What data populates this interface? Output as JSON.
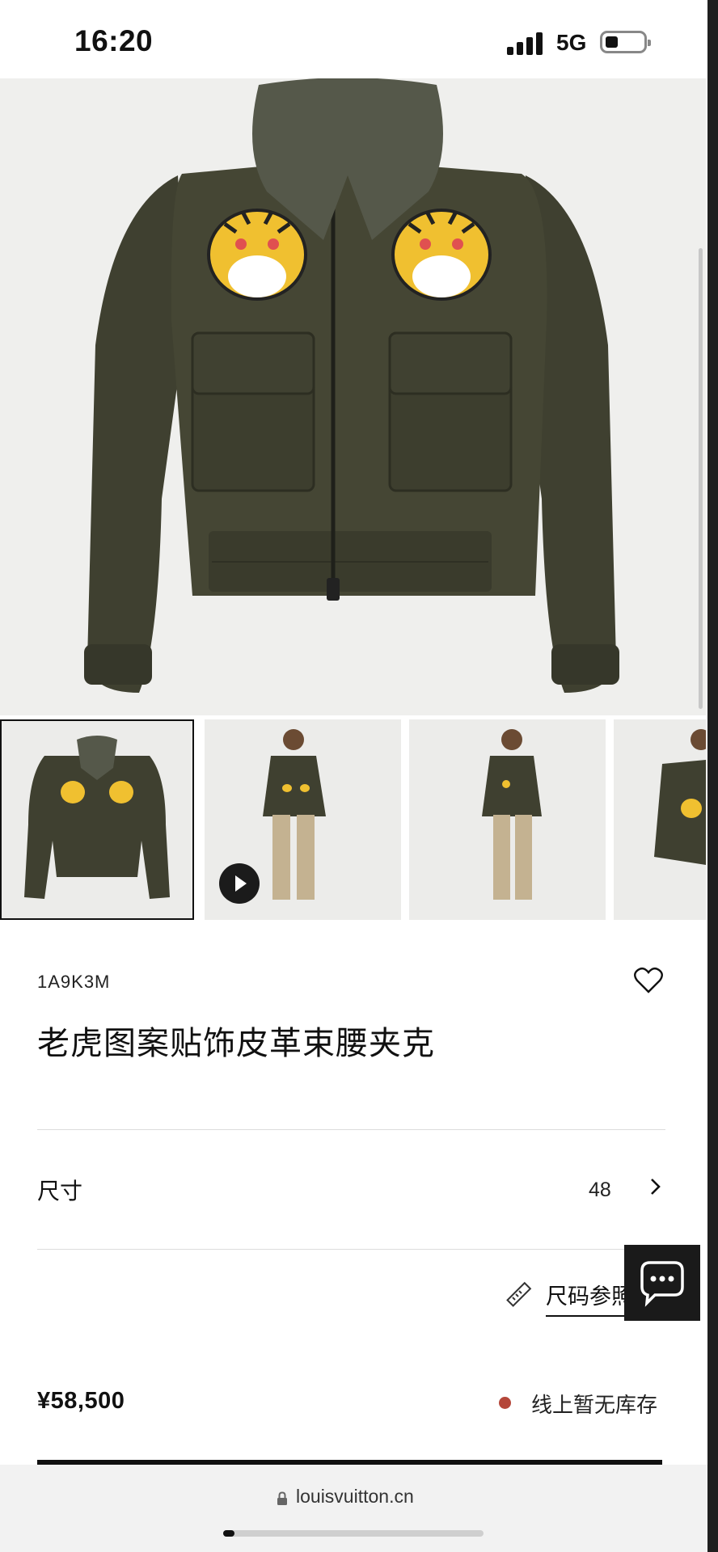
{
  "status_bar": {
    "time": "16:20",
    "network": "5G",
    "battery_level": 0.35
  },
  "gallery": {
    "hero_alt": "leather jacket with tiger patches",
    "thumbnails": [
      {
        "kind": "product",
        "selected": true
      },
      {
        "kind": "model-video",
        "selected": false
      },
      {
        "kind": "model",
        "selected": false
      },
      {
        "kind": "model-partial",
        "selected": false
      }
    ]
  },
  "product": {
    "sku": "1A9K3M",
    "title": "老虎图案贴饰皮革束腰夹克",
    "price": "¥58,500"
  },
  "size": {
    "label": "尺寸",
    "value": "48"
  },
  "size_guide": {
    "label": "尺码参照"
  },
  "stock": {
    "text": "线上暂无库存",
    "color": "#b5473a"
  },
  "browser": {
    "url": "louisvuitton.cn"
  },
  "colors": {
    "jacket": "#3f4030",
    "collar": "#55584a",
    "tiger_yellow": "#f0c030"
  }
}
